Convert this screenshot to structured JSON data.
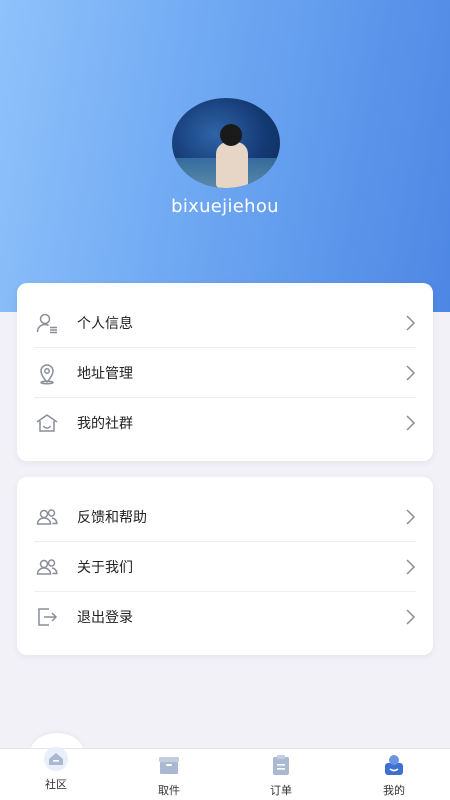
{
  "profile": {
    "username": "bixuejiehou"
  },
  "menu_group_1": [
    {
      "label": "个人信息",
      "icon": "user-list-icon"
    },
    {
      "label": "地址管理",
      "icon": "location-pin-icon"
    },
    {
      "label": "我的社群",
      "icon": "community-house-icon"
    }
  ],
  "menu_group_2": [
    {
      "label": "反馈和帮助",
      "icon": "people-icon"
    },
    {
      "label": "关于我们",
      "icon": "people-icon"
    },
    {
      "label": "退出登录",
      "icon": "logout-icon"
    }
  ],
  "tabbar": [
    {
      "label": "社区",
      "icon": "home-icon"
    },
    {
      "label": "取件",
      "icon": "package-box-icon"
    },
    {
      "label": "订单",
      "icon": "clipboard-icon"
    },
    {
      "label": "我的",
      "icon": "profile-icon"
    }
  ],
  "colors": {
    "hero_start": "#8fc2fb",
    "hero_end": "#4d87e4",
    "page_bg": "#f3f1f8",
    "icon_gray": "#8a8e99",
    "tab_icon": "#aab8d2",
    "tab_active": "#3f6fd0"
  }
}
